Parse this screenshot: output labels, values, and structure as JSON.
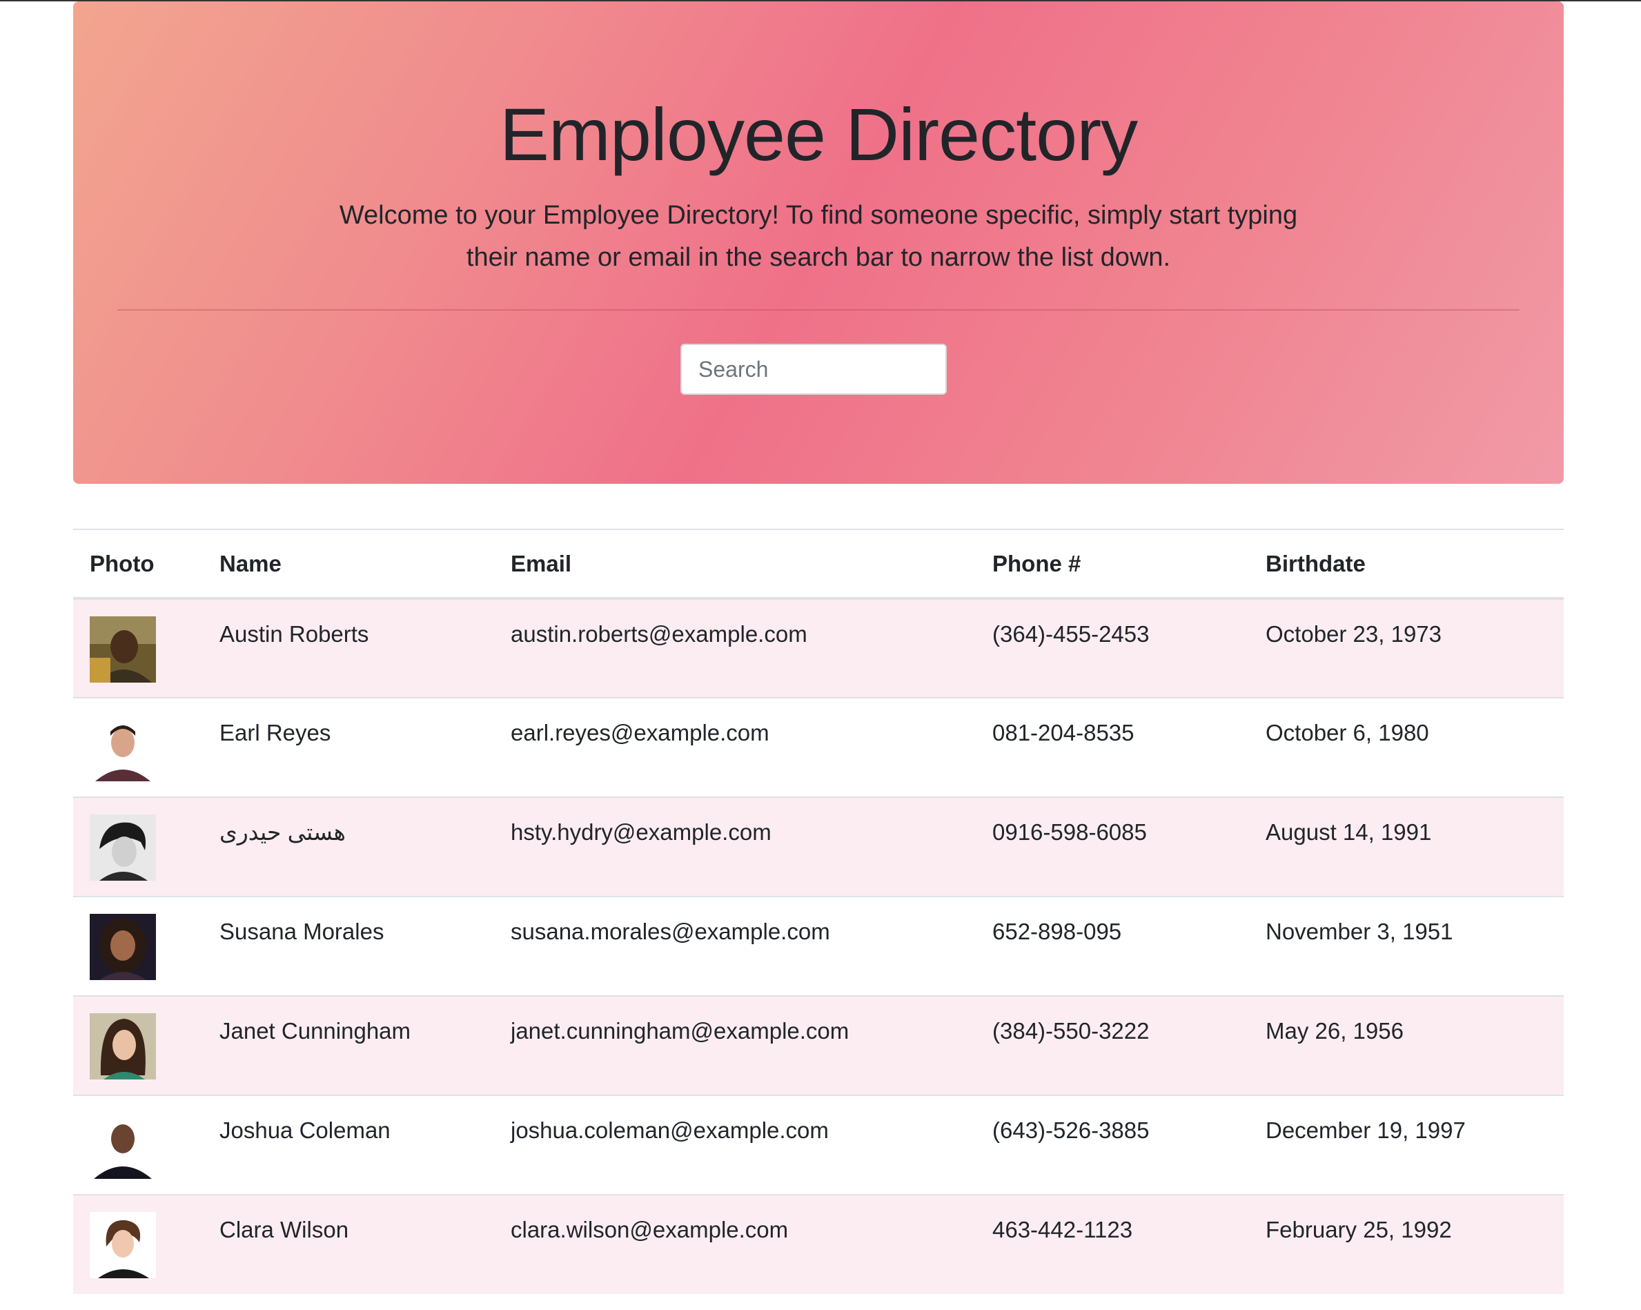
{
  "header": {
    "title": "Employee Directory",
    "lead": "Welcome to your Employee Directory! To find someone specific, simply start typing their name or email in the search bar to narrow the list down.",
    "search_placeholder": "Search"
  },
  "table": {
    "columns": [
      "Photo",
      "Name",
      "Email",
      "Phone #",
      "Birthdate"
    ],
    "rows": [
      {
        "photo": "avatar-photo",
        "name": "Austin Roberts",
        "email": "austin.roberts@example.com",
        "phone": "(364)-455-2453",
        "birthdate": "October 23, 1973"
      },
      {
        "photo": "avatar-photo",
        "name": "Earl Reyes",
        "email": "earl.reyes@example.com",
        "phone": "081-204-8535",
        "birthdate": "October 6, 1980"
      },
      {
        "photo": "avatar-photo",
        "name": "هستی حیدری",
        "email": "hsty.hydry@example.com",
        "phone": "0916-598-6085",
        "birthdate": "August 14, 1991"
      },
      {
        "photo": "avatar-photo",
        "name": "Susana Morales",
        "email": "susana.morales@example.com",
        "phone": "652-898-095",
        "birthdate": "November 3, 1951"
      },
      {
        "photo": "avatar-photo",
        "name": "Janet Cunningham",
        "email": "janet.cunningham@example.com",
        "phone": "(384)-550-3222",
        "birthdate": "May 26, 1956"
      },
      {
        "photo": "avatar-photo",
        "name": "Joshua Coleman",
        "email": "joshua.coleman@example.com",
        "phone": "(643)-526-3885",
        "birthdate": "December 19, 1997"
      },
      {
        "photo": "avatar-photo",
        "name": "Clara Wilson",
        "email": "clara.wilson@example.com",
        "phone": "463-442-1123",
        "birthdate": "February 25, 1992"
      }
    ]
  },
  "colors": {
    "jumbotron_gradient_start": "#f2a58f",
    "jumbotron_gradient_mid": "#ef7189",
    "jumbotron_gradient_end": "#f19aa7",
    "striped_row": "#fcedf2"
  }
}
